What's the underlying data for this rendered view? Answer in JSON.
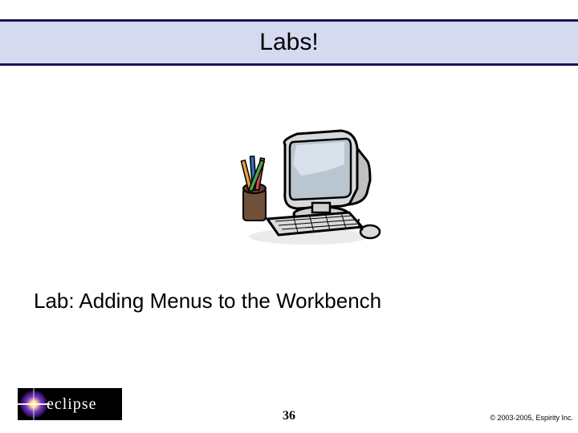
{
  "title": "Labs!",
  "lab_line": "Lab: Adding Menus to the Workbench",
  "logo_text": "eclipse",
  "page_number": "36",
  "copyright": "© 2003-2005, Espirity Inc.",
  "colors": {
    "title_band_bg": "#d6daf1",
    "title_band_rule": "#1b1559",
    "logo_bg": "#000000"
  },
  "clipart": {
    "name": "computer-with-pencil-cup-clipart"
  }
}
